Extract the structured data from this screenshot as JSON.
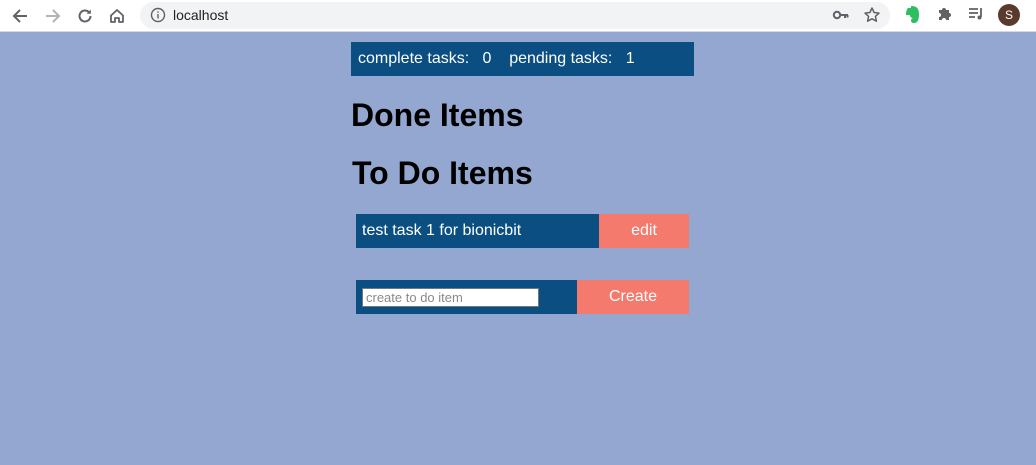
{
  "browser": {
    "url": "localhost",
    "profile_initial": "S",
    "icons": {
      "back": "back-arrow-icon",
      "forward": "forward-arrow-icon",
      "reload": "reload-icon",
      "home": "home-icon",
      "info": "info-icon",
      "key": "key-icon",
      "star": "star-icon",
      "evernote": "evernote-icon",
      "extensions": "puzzle-icon",
      "media": "media-control-icon"
    }
  },
  "stats": {
    "complete_label": "complete tasks:",
    "complete_count": "0",
    "pending_label": "pending tasks:",
    "pending_count": "1"
  },
  "done_section": {
    "title": "Done Items"
  },
  "todo_section": {
    "title": "To Do Items",
    "items": [
      {
        "title": "test task 1 for bionicbit",
        "action_label": "edit"
      }
    ]
  },
  "create": {
    "placeholder": "create to do item",
    "value": "",
    "button_label": "Create"
  },
  "colors": {
    "page_background": "#93a7d1",
    "bar_background": "#0b4e82",
    "button_background": "#f47a6e",
    "text_light": "#ffffff"
  }
}
